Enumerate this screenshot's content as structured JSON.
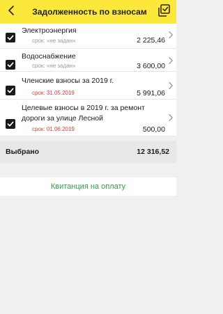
{
  "header": {
    "title": "Задолженность по взносам",
    "back_icon": "chevron-left-icon",
    "select_all_icon": "check-all-icon",
    "bg_color": "#fce83a"
  },
  "items": [
    {
      "name": "Электроэнергия",
      "due": "срок: «не задан»",
      "due_status": "gray",
      "amount": "2 225,46",
      "checked": true
    },
    {
      "name": "Водоснабжение",
      "due": "срок: «не задан»",
      "due_status": "gray",
      "amount": "3 600,00",
      "checked": true
    },
    {
      "name": "Членские взносы за 2019 г.",
      "due": "срок: 31.05.2019",
      "due_status": "red",
      "amount": "5 991,06",
      "checked": true
    },
    {
      "name": "Целевые взносы в 2019 г. за ремонт дороги за улице Лесной",
      "due": "срок: 01.06.2019",
      "due_status": "red",
      "amount": "500,00",
      "checked": true
    }
  ],
  "summary": {
    "label": "Выбрано",
    "total": "12 316,52"
  },
  "receipt_button": {
    "label": "Квитанция на оплату",
    "color": "#2e9e3e"
  },
  "colors": {
    "due_red": "#e53935",
    "due_gray": "#9a9a9a"
  }
}
